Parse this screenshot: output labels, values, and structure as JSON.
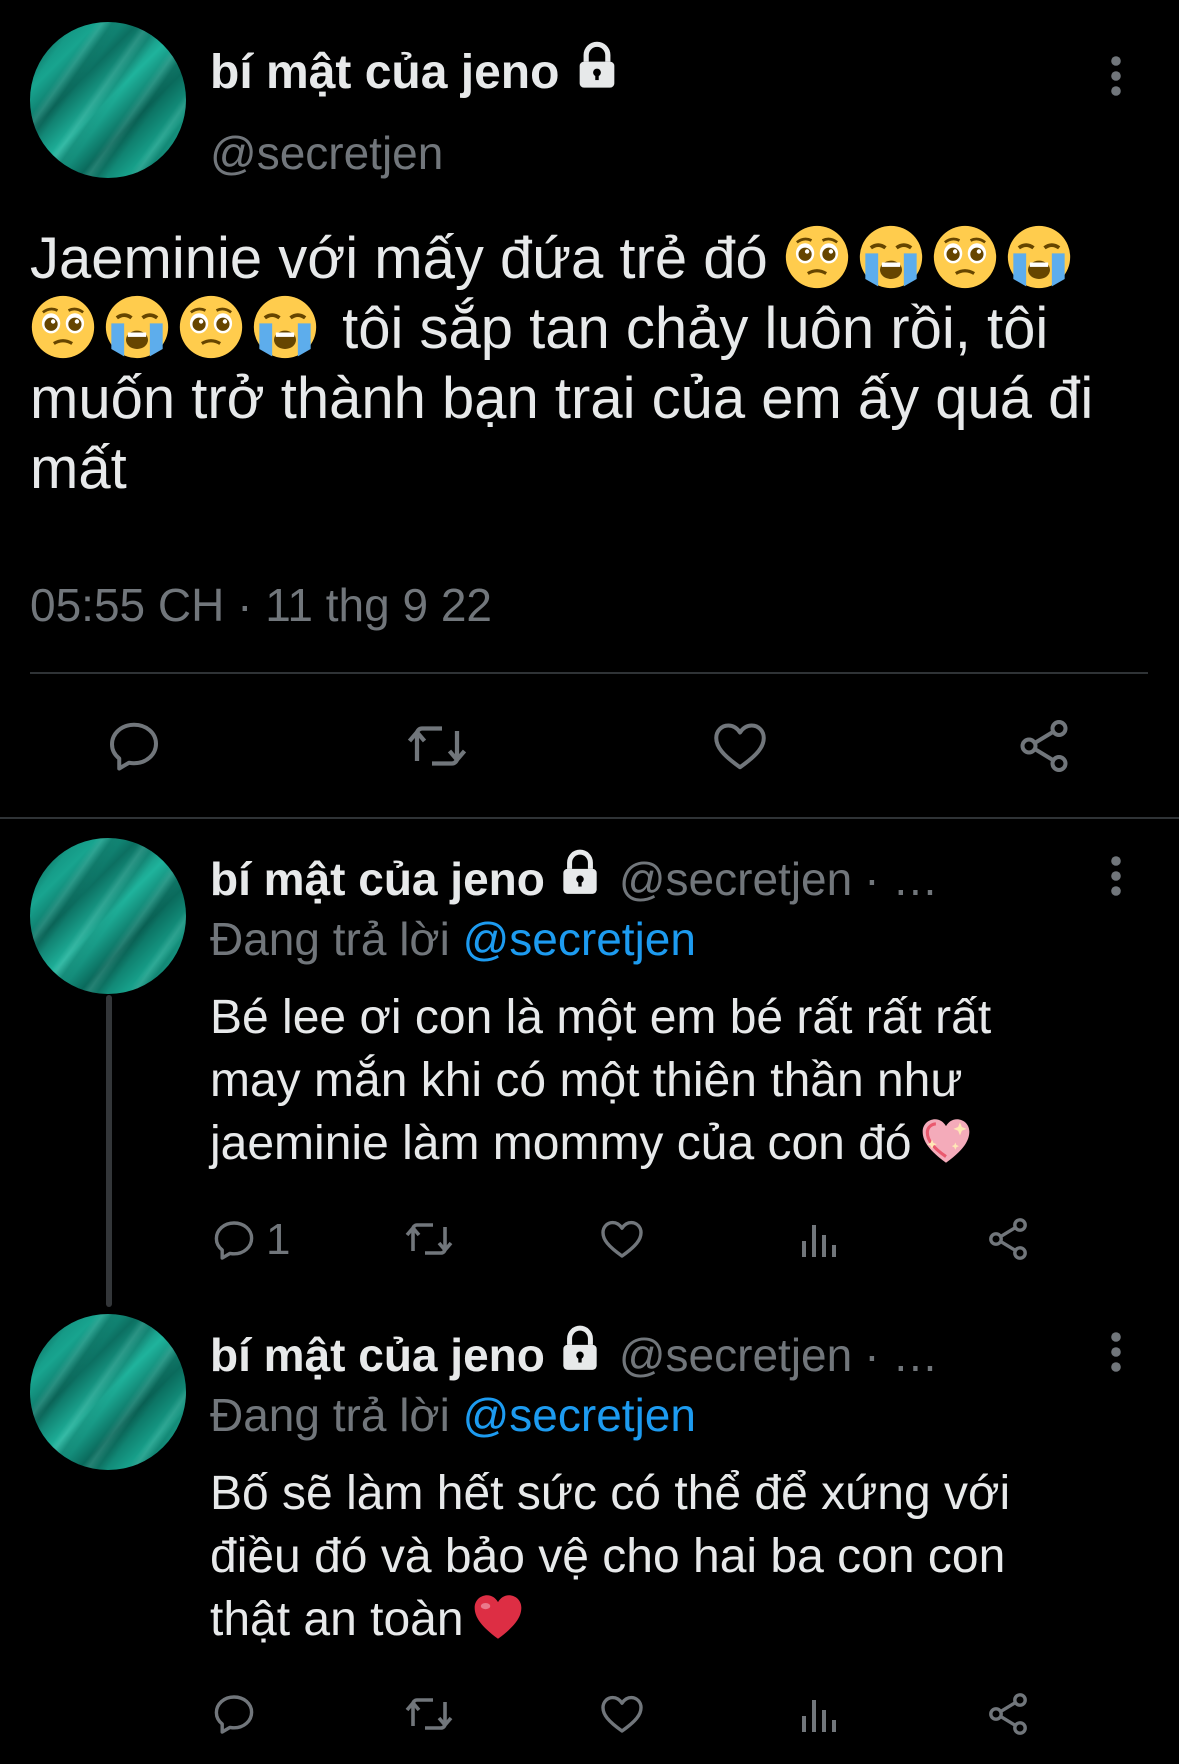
{
  "colors": {
    "background": "#000000",
    "text": "#e7e9ea",
    "secondary": "#71767b",
    "link": "#1d9bf0",
    "avatar": "#13998a",
    "divider": "#2f3336"
  },
  "main_tweet": {
    "display_name": "bí mật của jeno",
    "handle": "@secretjen",
    "text_part1": "Jaeminie với mấy đứa trẻ đó",
    "text_part2": "tôi sắp tan chảy luôn rồi, tôi muốn trở thành bạn trai của em ấy quá đi mất",
    "emojis": [
      "pleading-face",
      "crying-face",
      "pleading-face",
      "crying-face",
      "pleading-face",
      "crying-face",
      "pleading-face",
      "crying-face"
    ],
    "timestamp": "05:55 CH · 11 thg 9 22",
    "icons": [
      "lock-icon",
      "more-options-icon",
      "reply-icon",
      "retweet-icon",
      "like-icon",
      "share-icon"
    ]
  },
  "replies": [
    {
      "display_name": "bí mật của jeno",
      "handle": "@secretjen",
      "separator": "· …",
      "replying_prefix": "Đang trả lời",
      "replying_to": "@secretjen",
      "text": "Bé lee ơi con là một em bé rất rất rất may mắn khi có một thiên thần như jaeminie làm mommy của con đó",
      "emoji": "sparkling-heart",
      "reply_count": "1"
    },
    {
      "display_name": "bí mật của jeno",
      "handle": "@secretjen",
      "separator": "· …",
      "replying_prefix": "Đang trả lời",
      "replying_to": "@secretjen",
      "text": "Bố sẽ làm hết sức có thể để xứng với điều đó và bảo vệ cho hai ba con con thật an toàn",
      "emoji": "red-heart",
      "reply_count": ""
    }
  ]
}
